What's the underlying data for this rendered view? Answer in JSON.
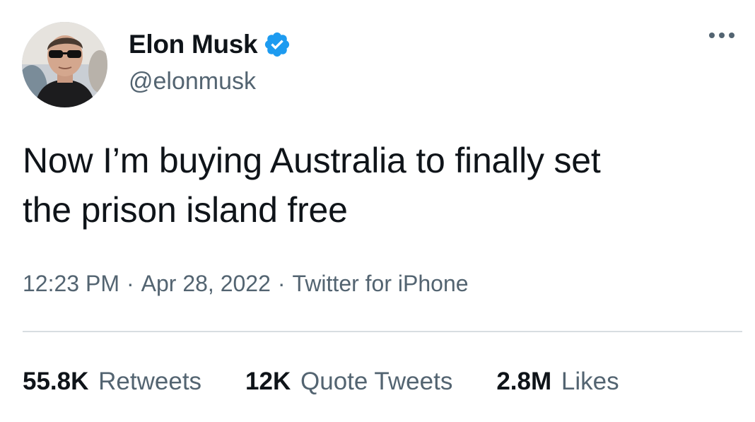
{
  "author": {
    "display_name": "Elon Musk",
    "handle": "@elonmusk",
    "verified": true,
    "verified_icon": "verified-badge-icon",
    "verified_color": "#1d9bf0",
    "avatar_icon": "profile-photo"
  },
  "more_icon": "more-options-icon",
  "tweet": {
    "text_line1": "Now I’m buying Australia to finally set",
    "text_line2": "the prison island free",
    "time": "12:23 PM",
    "date": "Apr 28, 2022",
    "source": "Twitter for iPhone",
    "separator": "·"
  },
  "stats": {
    "retweets_count": "55.8K",
    "retweets_label": "Retweets",
    "quotes_count": "12K",
    "quotes_label": "Quote Tweets",
    "likes_count": "2.8M",
    "likes_label": "Likes"
  },
  "colors": {
    "text": "#0f1419",
    "secondary_text": "#536471",
    "divider": "#d8dde1",
    "background": "#ffffff"
  }
}
